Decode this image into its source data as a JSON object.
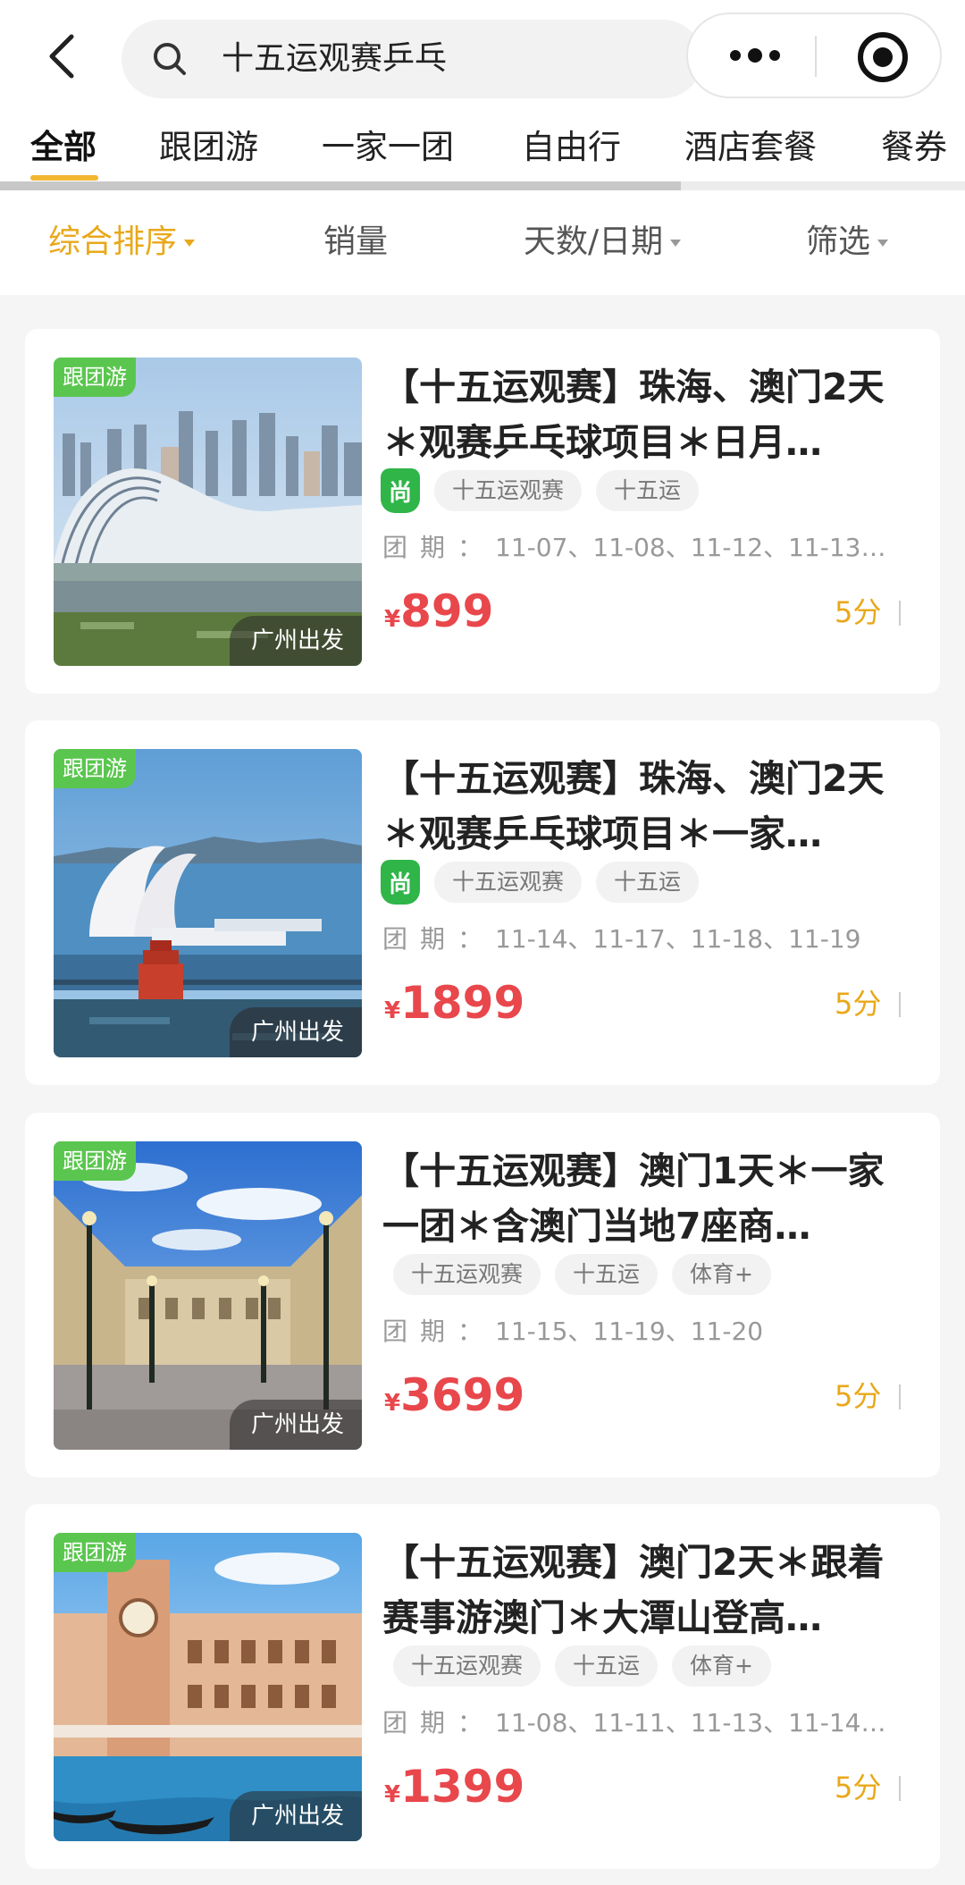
{
  "search": {
    "query": "十五运观赛乒乓"
  },
  "tabs": [
    {
      "label": "全部",
      "active": true
    },
    {
      "label": "跟团游"
    },
    {
      "label": "一家一团"
    },
    {
      "label": "自由行"
    },
    {
      "label": "酒店套餐"
    },
    {
      "label": "餐券"
    }
  ],
  "sort": [
    {
      "label": "综合排序",
      "active": true,
      "caret": true
    },
    {
      "label": "销量"
    },
    {
      "label": "天数/日期",
      "caret": true
    },
    {
      "label": "筛选",
      "caret": true
    }
  ],
  "products": [
    {
      "badge": "跟团游",
      "depart": "广州出发",
      "title": "【十五运观赛】珠海、澳门2天＊观赛乒乓球项目＊日月…",
      "shang_icon": "尚",
      "tags": [
        "十五运观赛",
        "十五运"
      ],
      "dates_label": "团期：",
      "dates": "11-07、11-08、11-12、11-13…",
      "currency": "¥",
      "price": "899",
      "score": "5分"
    },
    {
      "badge": "跟团游",
      "depart": "广州出发",
      "title": "【十五运观赛】珠海、澳门2天＊观赛乒乓球项目＊一家…",
      "shang_icon": "尚",
      "tags": [
        "十五运观赛",
        "十五运"
      ],
      "dates_label": "团期：",
      "dates": "11-14、11-17、11-18、11-19",
      "currency": "¥",
      "price": "1899",
      "score": "5分"
    },
    {
      "badge": "跟团游",
      "depart": "广州出发",
      "title": "【十五运观赛】澳门1天＊一家一团＊含澳门当地7座商…",
      "tags": [
        "十五运观赛",
        "十五运",
        "体育+"
      ],
      "dates_label": "团期：",
      "dates": "11-15、11-19、11-20",
      "currency": "¥",
      "price": "3699",
      "score": "5分"
    },
    {
      "badge": "跟团游",
      "depart": "广州出发",
      "title": "【十五运观赛】澳门2天＊跟着赛事游澳门＊大潭山登高…",
      "tags": [
        "十五运观赛",
        "十五运",
        "体育+"
      ],
      "dates_label": "团期：",
      "dates": "11-08、11-11、11-13、11-14…",
      "currency": "¥",
      "price": "1399",
      "score": "5分"
    }
  ]
}
